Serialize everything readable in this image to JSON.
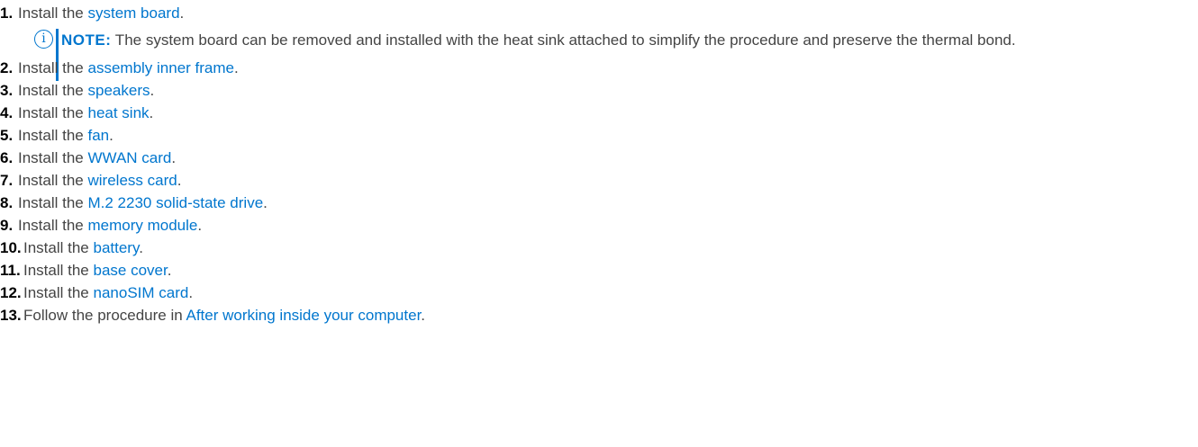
{
  "steps": [
    {
      "number": "1.",
      "prefix": "Install the ",
      "link": "system board",
      "suffix": "."
    },
    {
      "number": "2.",
      "prefix": "Install the ",
      "link": "assembly inner frame",
      "suffix": "."
    },
    {
      "number": "3.",
      "prefix": "Install the ",
      "link": "speakers",
      "suffix": "."
    },
    {
      "number": "4.",
      "prefix": "Install the ",
      "link": "heat sink",
      "suffix": "."
    },
    {
      "number": "5.",
      "prefix": "Install the ",
      "link": "fan",
      "suffix": "."
    },
    {
      "number": "6.",
      "prefix": "Install the ",
      "link": "WWAN card",
      "suffix": "."
    },
    {
      "number": "7.",
      "prefix": "Install the ",
      "link": "wireless card",
      "suffix": "."
    },
    {
      "number": "8.",
      "prefix": "Install the ",
      "link": "M.2 2230 solid-state drive",
      "suffix": "."
    },
    {
      "number": "9.",
      "prefix": "Install the ",
      "link": "memory module",
      "suffix": "."
    },
    {
      "number": "10.",
      "prefix": "Install the ",
      "link": "battery",
      "suffix": "."
    },
    {
      "number": "11.",
      "prefix": "Install the ",
      "link": "base cover",
      "suffix": "."
    },
    {
      "number": "12.",
      "prefix": "Install the ",
      "link": "nanoSIM card",
      "suffix": "."
    },
    {
      "number": "13.",
      "prefix": "Follow the procedure in ",
      "link": "After working inside your computer",
      "suffix": "."
    }
  ],
  "note": {
    "label": "NOTE:",
    "text": " The system board can be removed and installed with the heat sink attached to simplify the procedure and preserve the thermal bond.",
    "icon": "info-icon",
    "icon_glyph": "i",
    "accent_color": "#0076ce"
  }
}
